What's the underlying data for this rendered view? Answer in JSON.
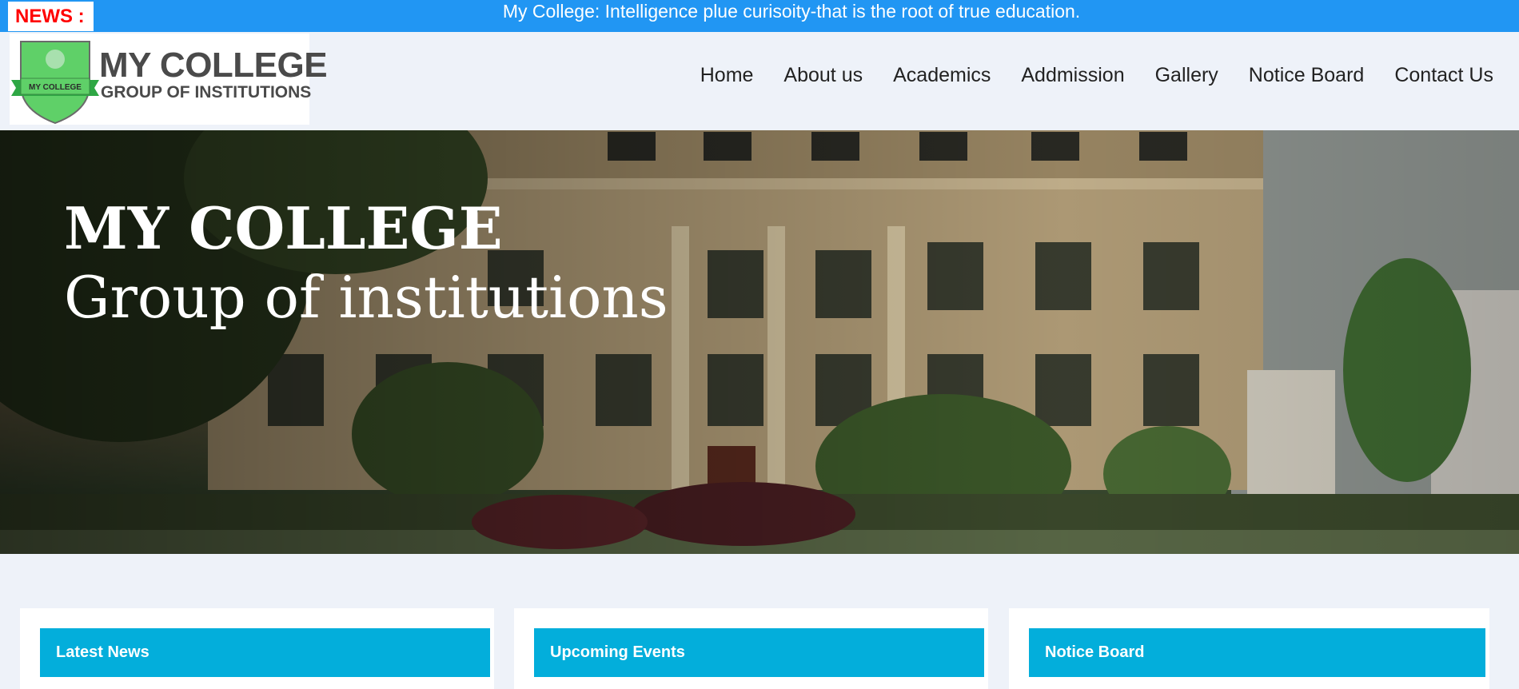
{
  "news": {
    "label": "NEWS :",
    "text": "My College: Intelligence plue curisoity-that is the root of true education."
  },
  "logo": {
    "title": "MY COLLEGE",
    "subtitle": "GROUP OF INSTITUTIONS",
    "banner_text": "MY COLLEGE"
  },
  "nav": {
    "items": [
      "Home",
      "About us",
      "Academics",
      "Addmission",
      "Gallery",
      "Notice Board",
      "Contact Us"
    ]
  },
  "hero": {
    "title": "MY COLLEGE",
    "subtitle": "Group of institutions"
  },
  "cards": [
    {
      "title": "Latest News"
    },
    {
      "title": "Upcoming Events"
    },
    {
      "title": "Notice Board"
    }
  ],
  "colors": {
    "news_bar": "#2196f3",
    "news_label": "#ff0000",
    "card_header": "#03aedb",
    "page_bg": "#eef2f9",
    "logo_shield": "#5fd068"
  }
}
